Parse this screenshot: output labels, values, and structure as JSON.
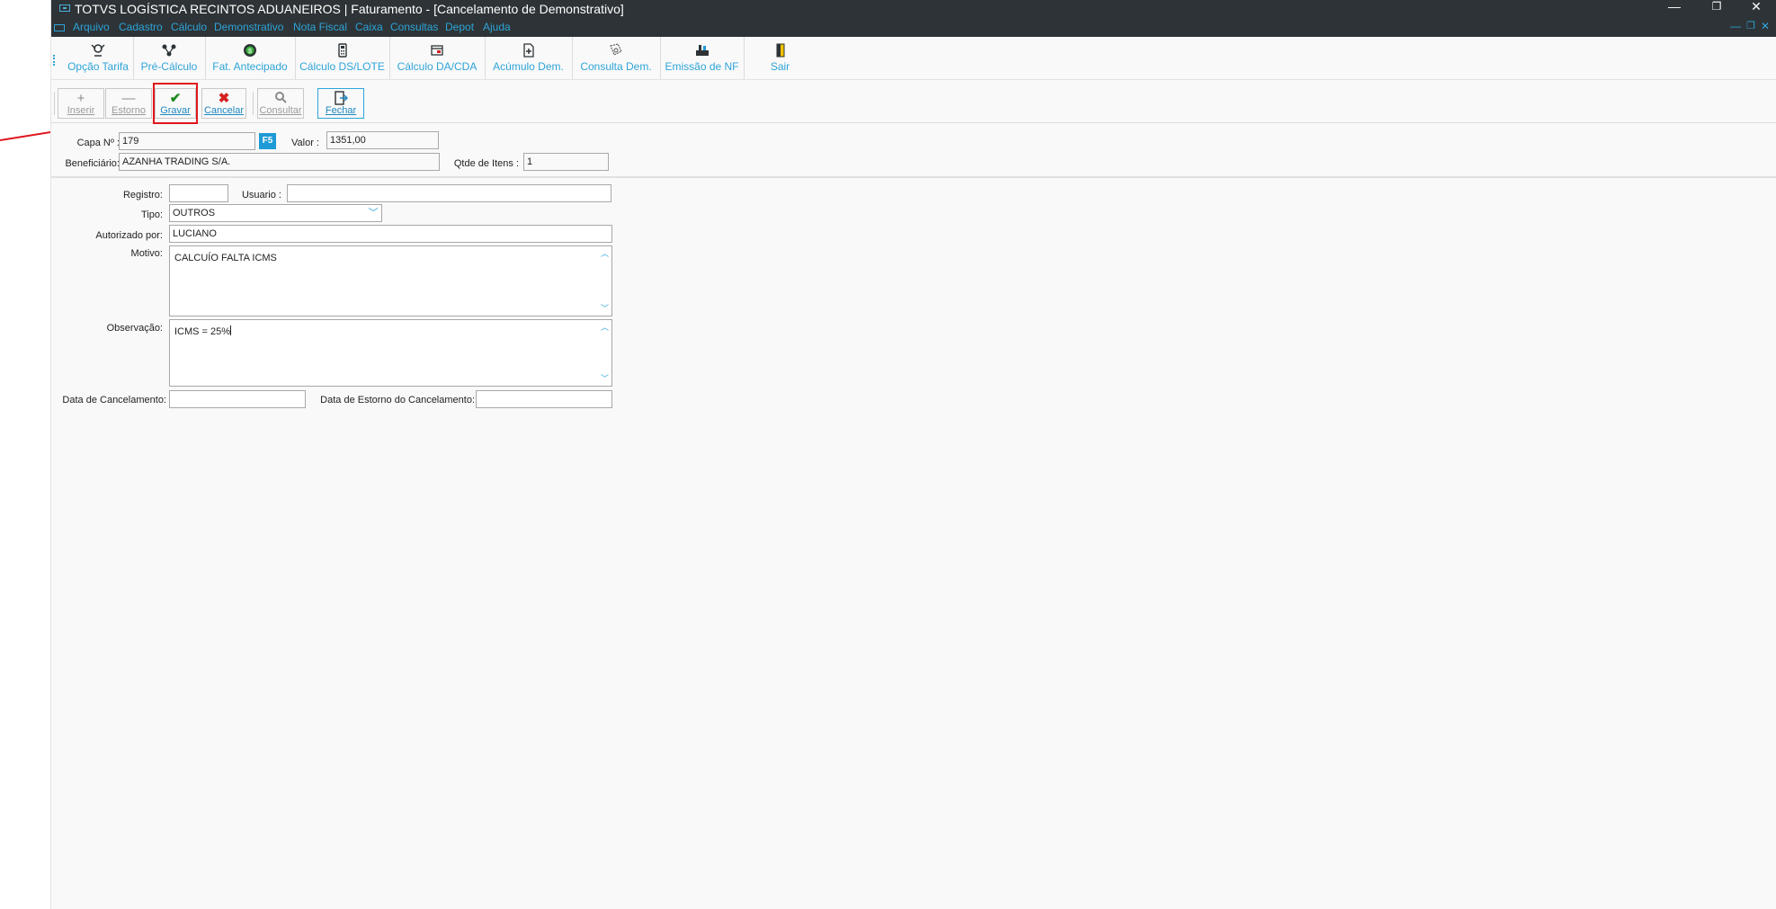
{
  "window": {
    "title": "TOTVS LOGÍSTICA RECINTOS ADUANEIROS | Faturamento - [Cancelamento de Demonstrativo]",
    "controls": {
      "minimize": "—",
      "restore": "❐",
      "close": "✕"
    }
  },
  "menubar": {
    "items": [
      "Arquivo",
      "Cadastro",
      "Cálculo",
      "Demonstrativo",
      "Nota Fiscal",
      "Caixa",
      "Consultas",
      "Depot",
      "Ajuda"
    ],
    "mdi_controls": {
      "minimize": "—",
      "restore": "❐",
      "close": "✕"
    }
  },
  "toolbar_main": {
    "items": [
      {
        "label": "Opção Tarifa",
        "icon": "tariff-option-icon"
      },
      {
        "label": "Pré-Cálculo",
        "icon": "pre-calculation-icon"
      },
      {
        "label": "Fat. Antecipado",
        "icon": "advance-billing-icon"
      },
      {
        "label": "Cálculo DS/LOTE",
        "icon": "calculator-icon"
      },
      {
        "label": "Cálculo DA/CDA",
        "icon": "window-calc-icon"
      },
      {
        "label": "Acúmulo Dem.",
        "icon": "accumulate-doc-icon"
      },
      {
        "label": "Consulta Dem.",
        "icon": "query-doc-icon"
      },
      {
        "label": "Emissão de NF",
        "icon": "invoice-issue-icon"
      },
      {
        "label": "Sair",
        "icon": "exit-door-icon"
      }
    ]
  },
  "toolbar_actions": {
    "inserir": "Inserir",
    "estorno": "Estorno",
    "gravar": "Gravar",
    "cancelar": "Cancelar",
    "consultar": "Consultar",
    "fechar": "Fechar"
  },
  "header": {
    "capa_label": "Capa Nº :",
    "capa_value": "179",
    "f5_label": "F5",
    "valor_label": "Valor :",
    "valor_value": "1351,00",
    "beneficiario_label": "Beneficiário:",
    "beneficiario_value": "AZANHA TRADING S/A.",
    "qtde_label": "Qtde de Itens :",
    "qtde_value": "1"
  },
  "form": {
    "registro_label": "Registro:",
    "registro_value": "",
    "usuario_label": "Usuario :",
    "usuario_value": "",
    "tipo_label": "Tipo:",
    "tipo_value": "OUTROS",
    "autorizado_label": "Autorizado por:",
    "autorizado_value": "LUCIANO",
    "motivo_label": "Motivo:",
    "motivo_value": "CALCUÍO FALTA ICMS",
    "observacao_label": "Observação:",
    "observacao_value": "ICMS = 25%",
    "data_cancelamento_label": "Data  de Cancelamento:",
    "data_cancelamento_value": "",
    "data_estorno_label": "Data de Estorno do Cancelamento:",
    "data_estorno_value": ""
  },
  "colors": {
    "title_bg": "#2d3336",
    "accent": "#2ea4d8",
    "highlight": "#e0161c",
    "save_green": "#1f8a1f",
    "cancel_red": "#d42020"
  }
}
